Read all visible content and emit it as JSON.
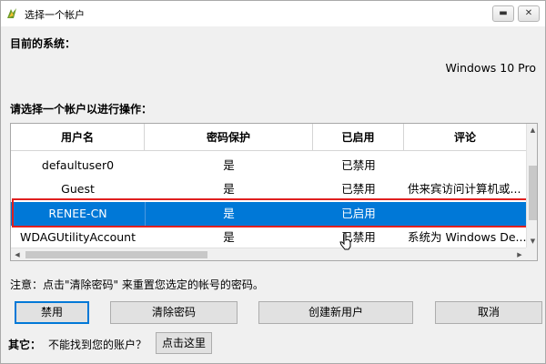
{
  "window": {
    "title": "选择一个帐户",
    "icon": "app-logo-icon",
    "minimize_glyph": "▬",
    "close_glyph": "✕"
  },
  "system": {
    "label": "目前的系统：",
    "value": "Windows 10 Pro"
  },
  "accounts": {
    "label": "请选择一个帐户以进行操作：",
    "columns": [
      "用户名",
      "密码保护",
      "已启用",
      "评论"
    ],
    "rows": [
      {
        "name": "defaultuser0",
        "password": "是",
        "enabled": "已禁用",
        "comment": ""
      },
      {
        "name": "Guest",
        "password": "是",
        "enabled": "已禁用",
        "comment": "供来宾访问计算机或..."
      },
      {
        "name": "RENEE-CN",
        "password": "是",
        "enabled": "已启用",
        "comment": ""
      },
      {
        "name": "WDAGUtilityAccount",
        "password": "是",
        "enabled": "已禁用",
        "comment": "系统为 Windows De..."
      }
    ],
    "selected_index": 2
  },
  "note": "注意：点击\"清除密码\" 来重置您选定的帐号的密码。",
  "buttons": {
    "disable": "禁用",
    "clear_password": "清除密码",
    "create_user": "创建新用户",
    "cancel": "取消"
  },
  "other": {
    "label": "其它：",
    "text": "不能找到您的账户？",
    "link_button": "点击这里"
  },
  "colors": {
    "selection": "#0078d7",
    "highlight_border": "#e02020"
  }
}
